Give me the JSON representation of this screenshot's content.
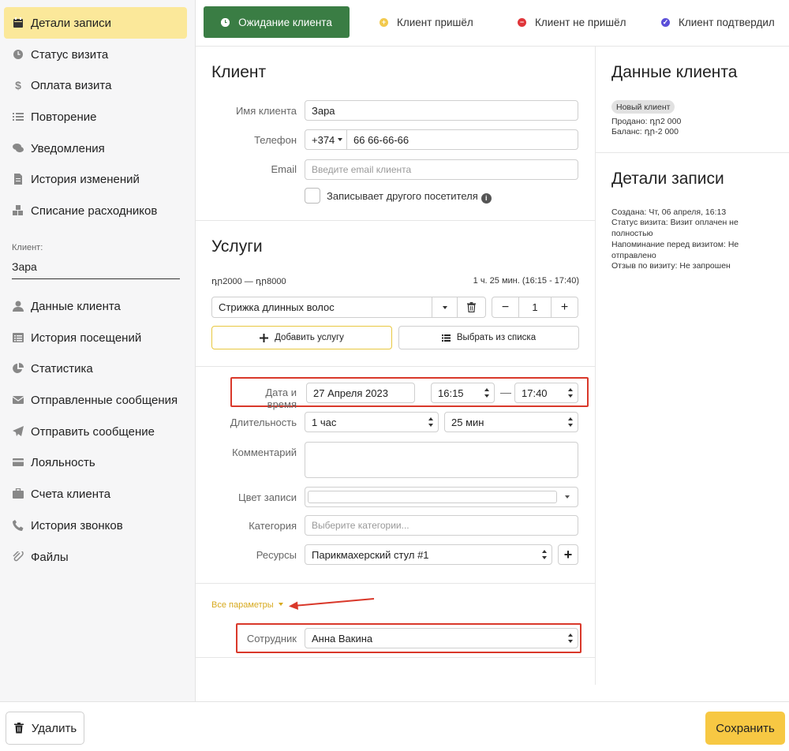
{
  "sidebar": {
    "items": [
      {
        "label": "Детали записи",
        "icon": "calendar-icon",
        "active": true
      },
      {
        "label": "Статус визита",
        "icon": "clock-icon"
      },
      {
        "label": "Оплата визита",
        "icon": "dollar-icon"
      },
      {
        "label": "Повторение",
        "icon": "list-icon"
      },
      {
        "label": "Уведомления",
        "icon": "comments-icon"
      },
      {
        "label": "История изменений",
        "icon": "document-icon"
      },
      {
        "label": "Списание расходников",
        "icon": "cubes-icon"
      }
    ],
    "client_label": "Клиент:",
    "client_value": "Зара",
    "client_items": [
      {
        "label": "Данные клиента",
        "icon": "user-icon"
      },
      {
        "label": "История посещений",
        "icon": "history-list-icon"
      },
      {
        "label": "Статистика",
        "icon": "pie-chart-icon"
      },
      {
        "label": "Отправленные сообщения",
        "icon": "envelope-icon"
      },
      {
        "label": "Отправить сообщение",
        "icon": "paper-plane-icon"
      },
      {
        "label": "Лояльность",
        "icon": "credit-card-icon"
      },
      {
        "label": "Счета клиента",
        "icon": "briefcase-icon"
      },
      {
        "label": "История звонков",
        "icon": "phone-icon"
      },
      {
        "label": "Файлы",
        "icon": "paperclip-icon"
      }
    ]
  },
  "tabs": [
    {
      "label": "Ожидание клиента",
      "icon": "clock-icon",
      "color": "#ffffff",
      "active": true
    },
    {
      "label": "Клиент пришёл",
      "icon": "plus-circle-icon",
      "color": "#f2c94c"
    },
    {
      "label": "Клиент не пришёл",
      "icon": "minus-circle-icon",
      "color": "#e0353a"
    },
    {
      "label": "Клиент подтвердил",
      "icon": "check-circle-icon",
      "color": "#5b4fd9"
    }
  ],
  "client": {
    "title": "Клиент",
    "name_label": "Имя клиента",
    "name_value": "Зара",
    "phone_label": "Телефон",
    "phone_code": "+374",
    "phone_value": "66 66-66-66",
    "email_label": "Email",
    "email_placeholder": "Введите email клиента",
    "other_visitor_label": "Записывает другого посетителя"
  },
  "services": {
    "title": "Услуги",
    "price_range": "դր2000 — դր8000",
    "duration_summary": "1 ч. 25 мин. (16:15 - 17:40)",
    "service_name": "Стрижка длинных волос",
    "quantity": "1",
    "add_service": "Добавить услугу",
    "choose_from_list": "Выбрать из списка"
  },
  "details": {
    "datetime_label": "Дата и время",
    "date_value": "27 Апреля 2023",
    "time_start": "16:15",
    "time_sep": "—",
    "time_end": "17:40",
    "duration_label": "Длительность",
    "duration_hours": "1 час",
    "duration_minutes": "25 мин",
    "comment_label": "Комментарий",
    "color_label": "Цвет записи",
    "category_label": "Категория",
    "category_placeholder": "Выберите категории...",
    "resources_label": "Ресурсы",
    "resources_value": "Парикмахерский стул #1",
    "all_params": "Все параметры",
    "employee_label": "Сотрудник",
    "employee_value": "Анна Вакина"
  },
  "right_panel": {
    "client_title": "Данные клиента",
    "client_badge": "Новый клиент",
    "sold": "Продано: դր2 000",
    "balance": "Баланс: դր-2 000",
    "record_title": "Детали записи",
    "created": "Создана: Чт, 06 апреля, 16:13",
    "visit_status": "Статус визита: Визит оплачен не полностью",
    "reminder": "Напоминание перед визитом: Не отправлено",
    "review": "Отзыв по визиту: Не запрошен"
  },
  "footer": {
    "delete_label": "Удалить",
    "save_label": "Сохранить"
  },
  "colors": {
    "accent_active_tab": "#3a7d44",
    "sidebar_active": "#fbe89a",
    "save_button": "#f7c843",
    "annotation_red": "#d9382a"
  }
}
